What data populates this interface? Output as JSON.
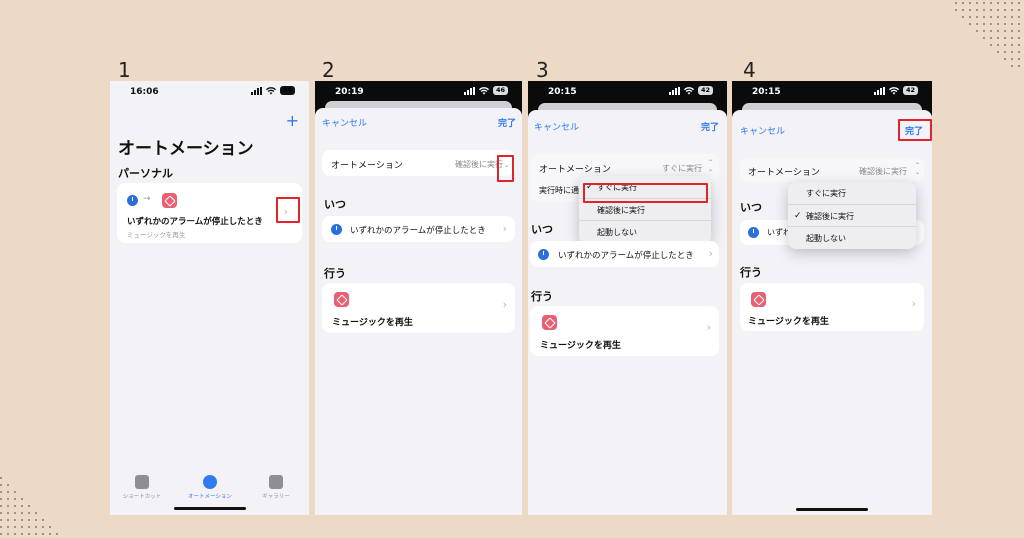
{
  "steps": [
    {
      "number": "1",
      "status": {
        "time": "16:06",
        "battery": "94"
      },
      "plus": "+",
      "title": "オートメーション",
      "section": "パーソナル",
      "automation_title": "いずれかのアラームが停止したとき",
      "automation_subtitle": "ミュージックを再生",
      "tabs": [
        "ショートカット",
        "オートメーション",
        "ギャラリー"
      ]
    },
    {
      "number": "2",
      "status": {
        "time": "20:19",
        "battery": "46"
      },
      "cancel": "キャンセル",
      "done": "完了",
      "automation_label": "オートメーション",
      "automation_value": "確認後に実行",
      "when_heading": "いつ",
      "trigger": "いずれかのアラームが停止したとき",
      "do_heading": "行う",
      "action": "ミュージックを再生"
    },
    {
      "number": "3",
      "status": {
        "time": "20:15",
        "battery": "42"
      },
      "cancel": "キャンセル",
      "done": "完了",
      "automation_label": "オートメーション",
      "automation_value": "すぐに実行",
      "notify_label": "実行時に通",
      "menu": [
        "すぐに実行",
        "確認後に実行",
        "起動しない"
      ],
      "when_heading": "いつ",
      "trigger": "いずれかのアラームが停止したとき",
      "do_heading": "行う",
      "action": "ミュージックを再生"
    },
    {
      "number": "4",
      "status": {
        "time": "20:15",
        "battery": "42"
      },
      "cancel": "キャンセル",
      "done": "完了",
      "automation_label": "オートメーション",
      "automation_value": "確認後に実行",
      "menu": [
        "すぐに実行",
        "確認後に実行",
        "起動しない"
      ],
      "when_heading": "いつ",
      "trigger_partial": "いずれ",
      "do_heading": "行う",
      "action": "ミュージックを再生"
    }
  ],
  "icons": {
    "chevron": "›",
    "updown": "⌃⌄",
    "check": "✓"
  },
  "colors": {
    "accent": "#2f7bf0",
    "highlight": "#e0242b",
    "shortcut_icon": "#e96072",
    "clock_icon": "#2d6fd8",
    "background": "#ecd9c6"
  }
}
